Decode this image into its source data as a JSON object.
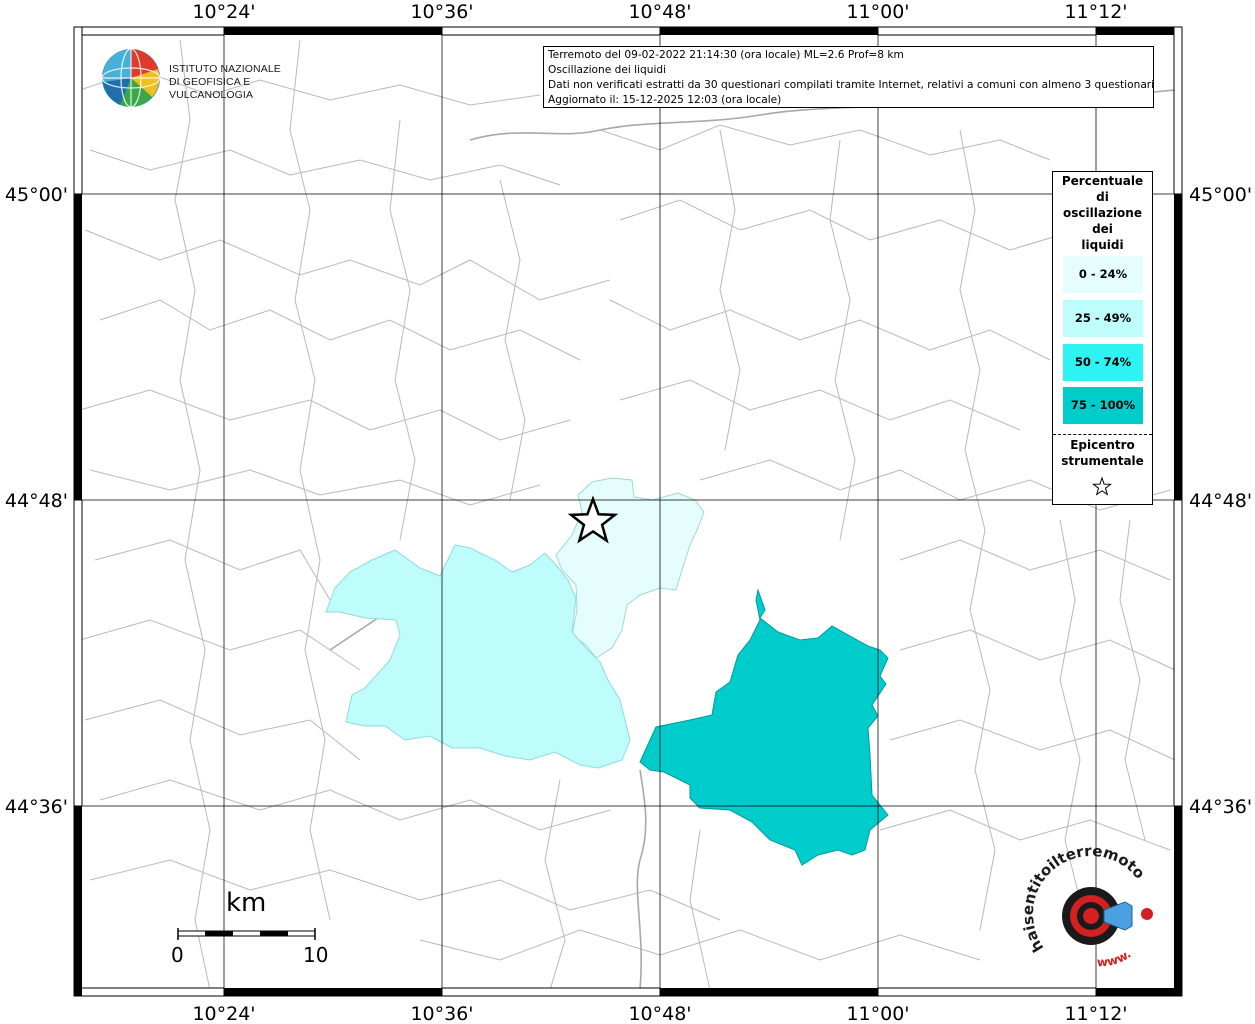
{
  "info": {
    "line1": "Terremoto del 09-02-2022 21:14:30 (ora locale) ML=2.6 Prof=8 km",
    "line2": "Oscillazione dei liquidi",
    "line3": "Dati non verificati estratti da 30 questionari compilati tramite Internet, relativi a comuni con almeno 3 questionari.",
    "line4": "Aggiornato il: 15-12-2025 12:03 (ora locale)"
  },
  "ingv_logo": {
    "line1": "ISTITUTO NAZIONALE",
    "line2": "DI GEOFISICA E VULCANOLOGIA"
  },
  "axes": {
    "top": [
      "10°24'",
      "10°36'",
      "10°48'",
      "11°00'",
      "11°12'"
    ],
    "bottom": [
      "10°24'",
      "10°36'",
      "10°48'",
      "11°00'",
      "11°12'"
    ],
    "left": [
      "45°00'",
      "44°48'",
      "44°36'"
    ],
    "right": [
      "45°00'",
      "44°48'",
      "44°36'"
    ]
  },
  "legend": {
    "title_lines": [
      "Percentuale",
      "di",
      "oscillazione",
      "dei",
      "liquidi"
    ],
    "classes": [
      {
        "label": "0 - 24%",
        "color": "#e6fdfd"
      },
      {
        "label": "25 - 49%",
        "color": "#bffcfc"
      },
      {
        "label": "50 - 74%",
        "color": "#2ff2f2"
      },
      {
        "label": "75 - 100%",
        "color": "#00cccc"
      }
    ],
    "epicenter_lines": [
      "Epicentro",
      "strumentale"
    ]
  },
  "scalebar": {
    "unit": "km",
    "min": "0",
    "max": "10"
  },
  "sentito_logo": {
    "text_top": "haisentitoilterremoto.it",
    "text_bottom": "www."
  },
  "regions": [
    {
      "name": "muni-0-24",
      "class": "0 - 24%"
    },
    {
      "name": "muni-25-49",
      "class": "25 - 49%"
    },
    {
      "name": "muni-75-100",
      "class": "75 - 100%"
    }
  ]
}
